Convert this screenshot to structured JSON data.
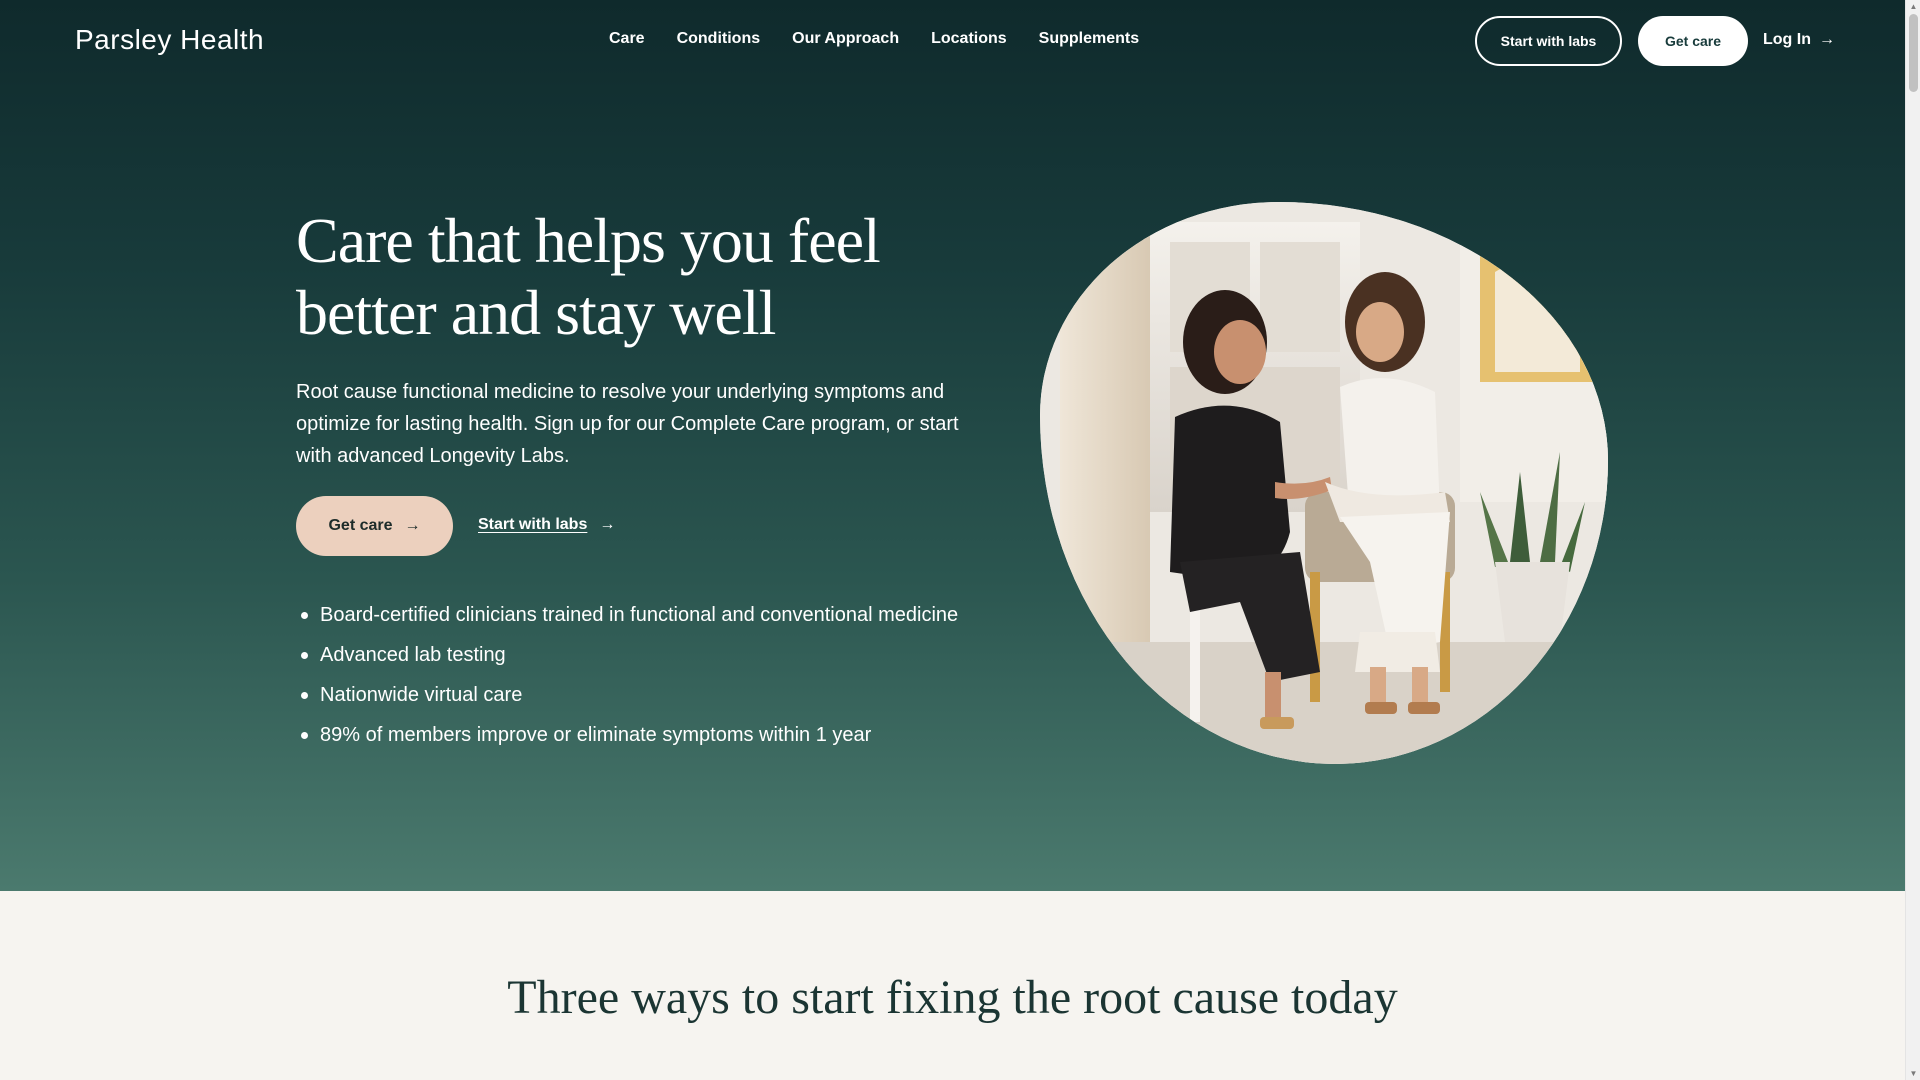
{
  "header": {
    "logo": "Parsley Health",
    "nav": [
      "Care",
      "Conditions",
      "Our Approach",
      "Locations",
      "Supplements"
    ],
    "labs_button": "Start with labs",
    "care_button": "Get care",
    "login": "Log In"
  },
  "hero": {
    "headline": "Care that helps you feel better and stay well",
    "subcopy": "Root cause functional medicine to resolve your underlying symptoms and optimize for lasting health. Sign up for our Complete Care program, or start with advanced Longevity Labs.",
    "primary_cta": "Get care",
    "secondary_cta": "Start with labs",
    "bullets": [
      "Board-certified clinicians trained in functional and conventional medicine",
      "Advanced lab testing",
      "Nationwide virtual care",
      "89% of members improve or eliminate symptoms within 1 year"
    ]
  },
  "section2": {
    "heading": "Three ways to start fixing the root cause today"
  },
  "icons": {
    "arrow": "arrow-right-icon",
    "bullet": "bullet-dot-icon"
  },
  "colors": {
    "hero_top": "#0f2a2c",
    "hero_bottom": "#4b7a6e",
    "cta_primary": "#ecd0be",
    "page_bg": "#f6f4f0"
  }
}
